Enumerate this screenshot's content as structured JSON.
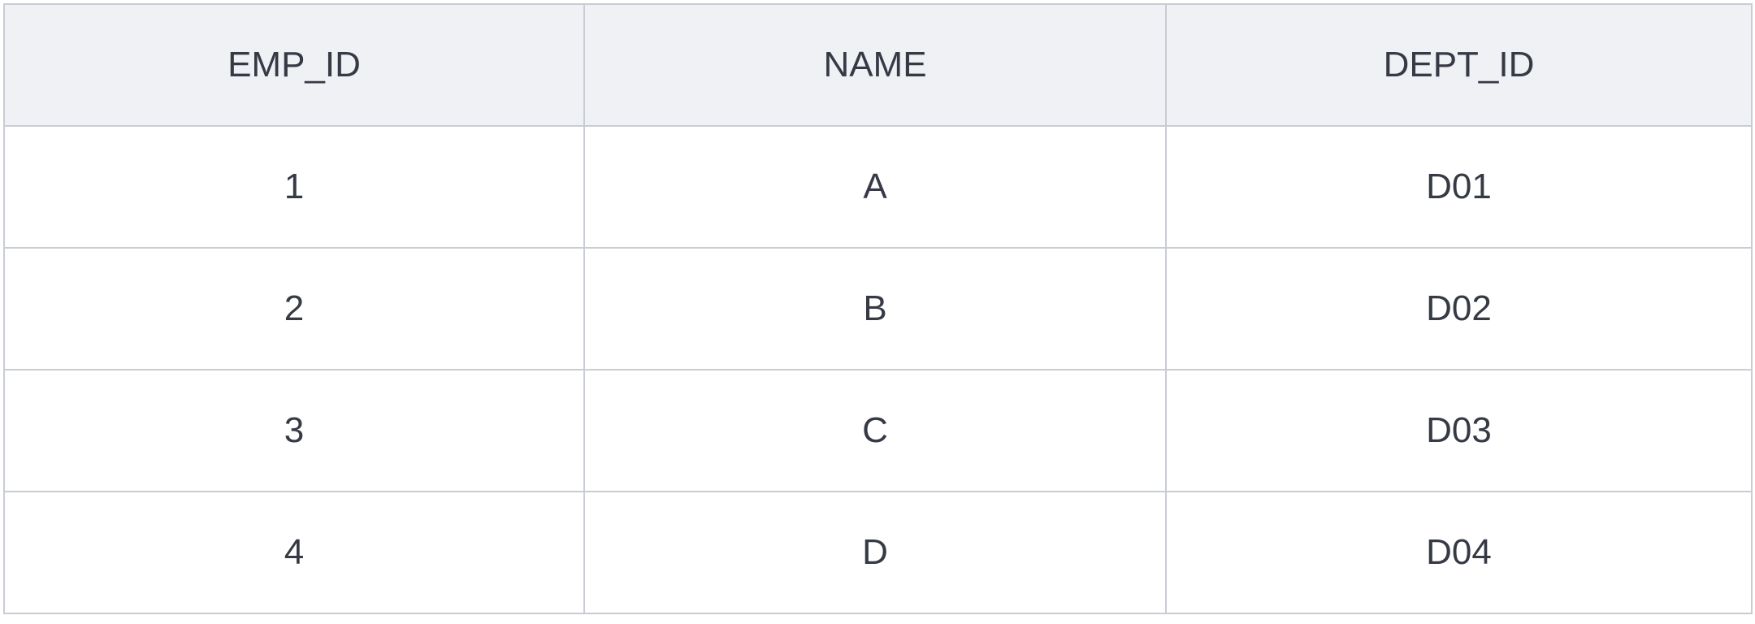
{
  "table": {
    "headers": [
      "EMP_ID",
      "NAME",
      "DEPT_ID"
    ],
    "rows": [
      [
        "1",
        "A",
        "D01"
      ],
      [
        "2",
        "B",
        "D02"
      ],
      [
        "3",
        "C",
        "D03"
      ],
      [
        "4",
        "D",
        "D04"
      ]
    ]
  },
  "colors": {
    "header_bg": "#eff1f5",
    "border": "#c8ccd4",
    "text": "#363a45"
  }
}
